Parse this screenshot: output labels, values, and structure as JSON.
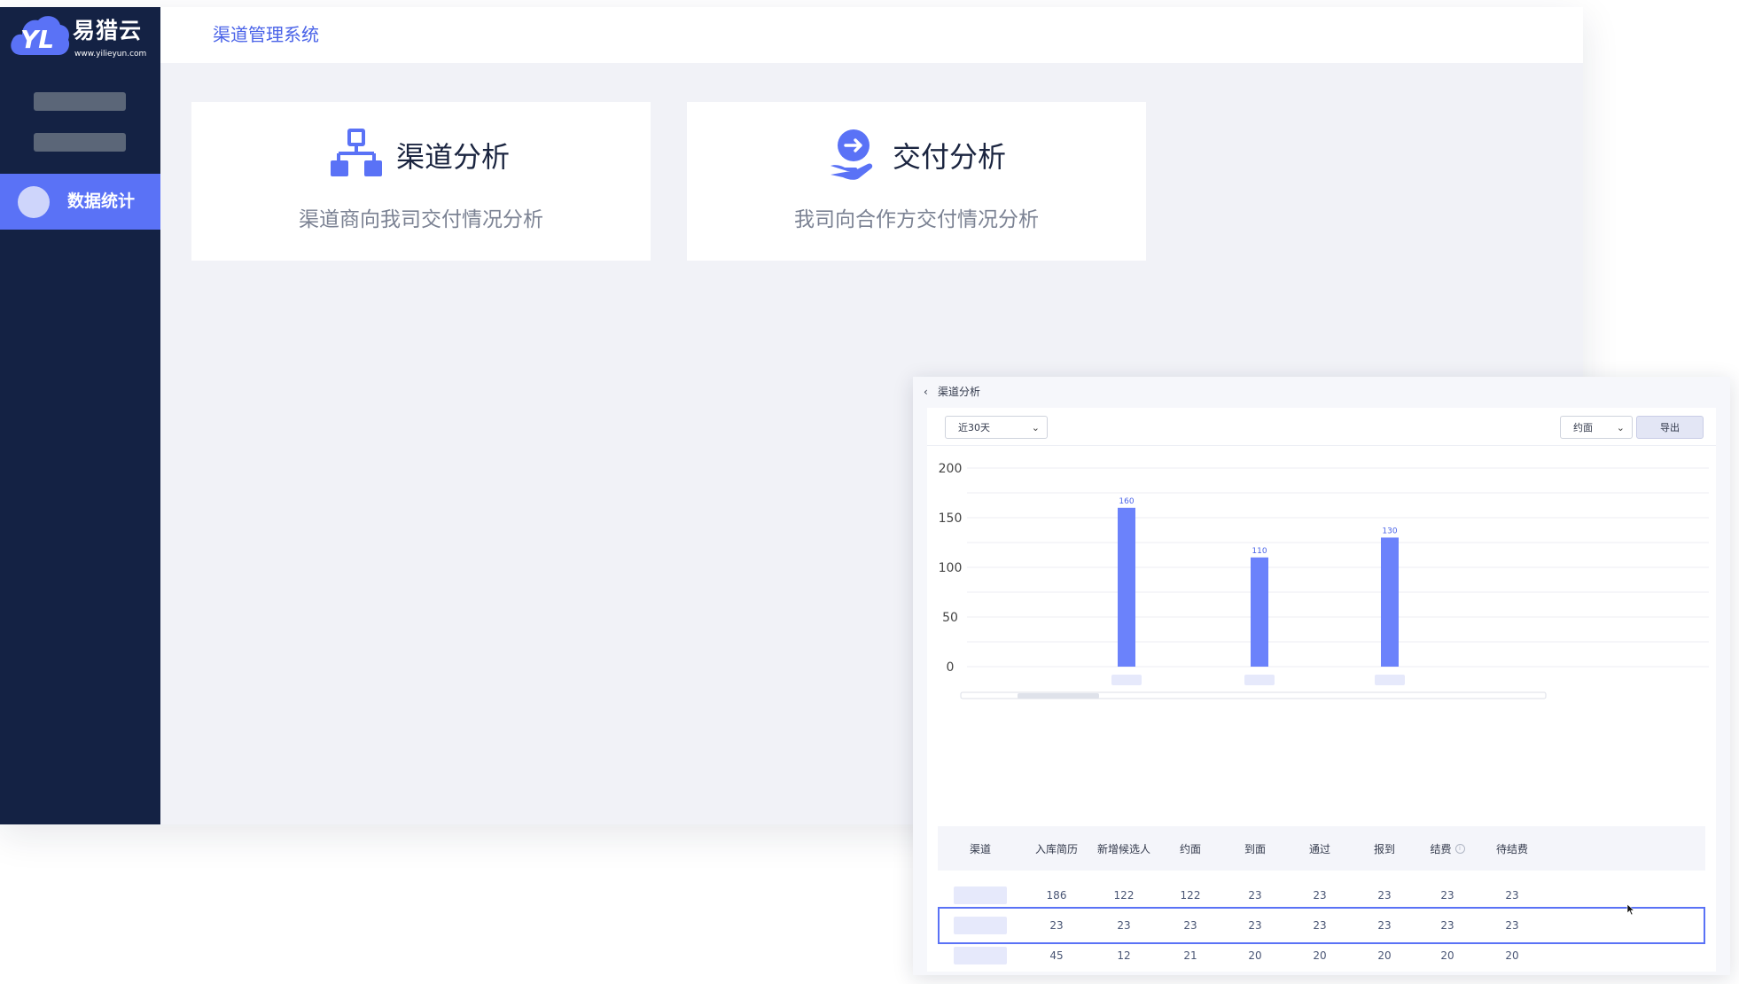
{
  "app": {
    "logo": {
      "name": "易猎云",
      "url": "www.yilieyun.com",
      "glyph": "YL"
    },
    "sidebar": {
      "active_item": {
        "label": "数据统计",
        "icon": "circle-icon"
      }
    },
    "topbar": {
      "title": "渠道管理系统"
    },
    "cards": [
      {
        "icon": "hierarchy-icon",
        "title": "渠道分析",
        "desc": "渠道商向我司交付情况分析"
      },
      {
        "icon": "hand-arrow-icon",
        "title": "交付分析",
        "desc": "我司向合作方交付情况分析"
      }
    ]
  },
  "analysis": {
    "back_label": "渠道分析",
    "date_select": "近30天",
    "metric_select": "约面",
    "export_label": "导出",
    "table": {
      "headers": [
        "渠道",
        "入库简历",
        "新增候选人",
        "约面",
        "到面",
        "通过",
        "报到",
        "结费",
        "待结费"
      ],
      "rows": [
        [
          "",
          "186",
          "122",
          "122",
          "23",
          "23",
          "23",
          "23",
          "23"
        ],
        [
          "",
          "23",
          "23",
          "23",
          "23",
          "23",
          "23",
          "23",
          "23"
        ],
        [
          "",
          "45",
          "12",
          "21",
          "20",
          "20",
          "20",
          "20",
          "20"
        ]
      ]
    }
  },
  "colors": {
    "accent": "#5a72f6",
    "sidebar": "#142244",
    "bar": "#6b82fb"
  },
  "chart_data": {
    "type": "bar",
    "categories": [
      "",
      "",
      ""
    ],
    "values": [
      160,
      110,
      130
    ],
    "data_labels": [
      "160",
      "110",
      "130"
    ],
    "y_ticks": [
      "0",
      "50",
      "100",
      "150",
      "200"
    ],
    "ylim": [
      0,
      200
    ],
    "title": "",
    "xlabel": "",
    "ylabel": "",
    "grid": true
  }
}
